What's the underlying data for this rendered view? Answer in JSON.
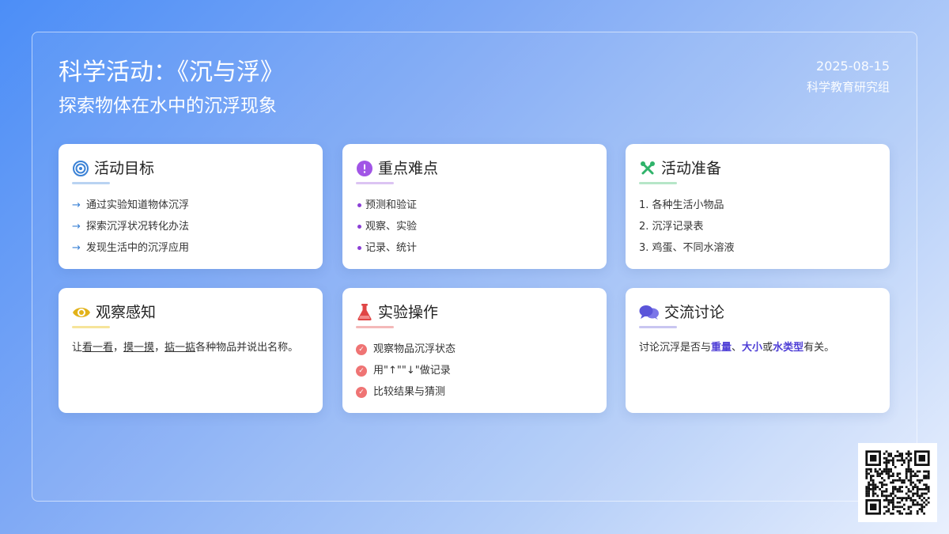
{
  "header": {
    "title": "科学活动：《沉与浮》",
    "subtitle": "探索物体在水中的沉浮现象",
    "date": "2025-08-15",
    "org": "科学教育研究组"
  },
  "cards": {
    "goals": {
      "title": "活动目标",
      "icon": "target-icon",
      "accent": "#3b82d6",
      "items": [
        "通过实验知道物体沉浮",
        "探索沉浮状况转化办法",
        "发现生活中的沉浮应用"
      ]
    },
    "keypoints": {
      "title": "重点难点",
      "icon": "exclamation-icon",
      "accent": "#9b4fe0",
      "items": [
        "预测和验证",
        "观察、实验",
        "记录、统计"
      ]
    },
    "prep": {
      "title": "活动准备",
      "icon": "tools-icon",
      "accent": "#2fb36a",
      "items": [
        "1. 各种生活小物品",
        "2. 沉浮记录表",
        "3. 鸡蛋、不同水溶液"
      ]
    },
    "observe": {
      "title": "观察感知",
      "icon": "eye-icon",
      "accent": "#e2b21a",
      "text": {
        "p1": "让",
        "u1": "看一看",
        "p2": "，",
        "u2": "摸一摸",
        "p3": "，",
        "u3": "掂一掂",
        "p4": "各种物品并说出名称。"
      }
    },
    "experiment": {
      "title": "实验操作",
      "icon": "flask-icon",
      "accent": "#e04646",
      "items": [
        "观察物品沉浮状态",
        "用\"↑\"\"↓\"做记录",
        "比较结果与猜测"
      ]
    },
    "discuss": {
      "title": "交流讨论",
      "icon": "chat-bubbles-icon",
      "accent": "#5b55d9",
      "text": {
        "p1": "讨论沉浮是否与",
        "h1": "重量",
        "p2": "、",
        "h2": "大小",
        "p3": "或",
        "h3": "水类型",
        "p4": "有关。"
      }
    }
  },
  "qr": {
    "icon": "qr-code-icon"
  }
}
